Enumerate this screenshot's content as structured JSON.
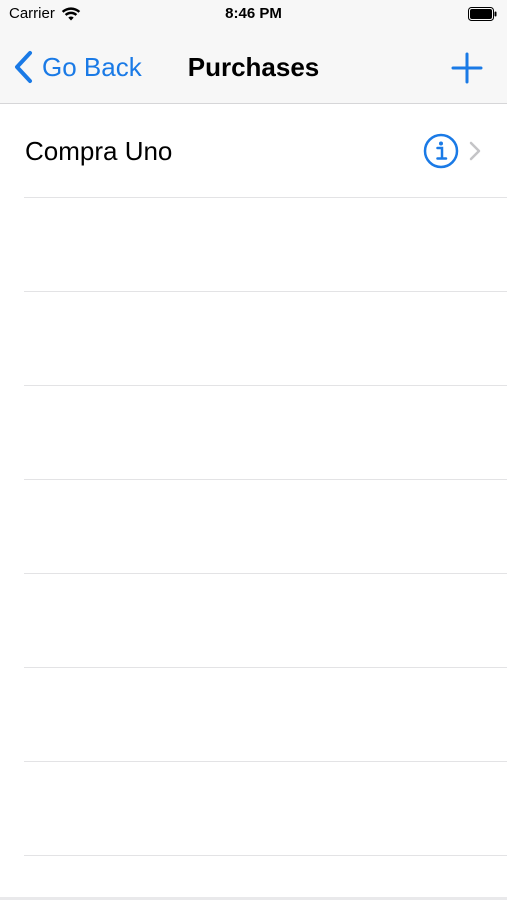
{
  "status_bar": {
    "carrier": "Carrier",
    "time": "8:46 PM",
    "icons": [
      "wifi-icon",
      "battery-icon"
    ]
  },
  "nav": {
    "back_label": "Go Back",
    "title": "Purchases",
    "add_icon": "plus-icon",
    "accent_color": "#1a7ae6"
  },
  "table": {
    "rows": [
      {
        "label": "Compra Uno",
        "icons": [
          "info-icon",
          "chevron-right-icon"
        ]
      },
      {
        "label": ""
      },
      {
        "label": ""
      },
      {
        "label": ""
      },
      {
        "label": ""
      },
      {
        "label": ""
      },
      {
        "label": ""
      },
      {
        "label": ""
      }
    ]
  }
}
